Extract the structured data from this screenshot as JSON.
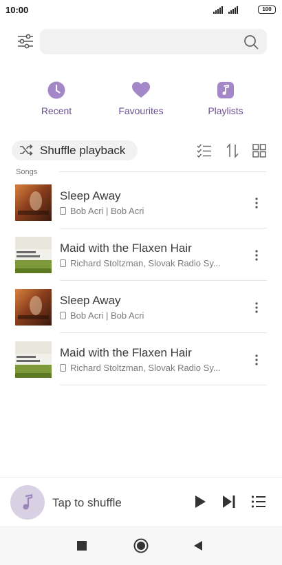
{
  "status_bar": {
    "time": "10:00",
    "battery": "100"
  },
  "search": {
    "placeholder": ""
  },
  "quick_access": [
    {
      "label": "Recent",
      "icon": "clock-icon"
    },
    {
      "label": "Favourites",
      "icon": "heart-icon"
    },
    {
      "label": "Playlists",
      "icon": "music-note-icon"
    }
  ],
  "toolbar": {
    "shuffle_label": "Shuffle playback"
  },
  "section": {
    "label": "Songs"
  },
  "songs": [
    {
      "title": "Sleep Away",
      "subtitle": "Bob Acri | Bob Acri"
    },
    {
      "title": "Maid with the Flaxen Hair",
      "subtitle": "Richard Stoltzman, Slovak Radio Sy..."
    },
    {
      "title": "Sleep Away",
      "subtitle": "Bob Acri | Bob Acri"
    },
    {
      "title": "Maid with the Flaxen Hair",
      "subtitle": "Richard Stoltzman, Slovak Radio Sy..."
    }
  ],
  "player": {
    "prompt": "Tap to shuffle"
  },
  "colors": {
    "accent": "#a487c7",
    "accent_text": "#6a4f8f"
  }
}
